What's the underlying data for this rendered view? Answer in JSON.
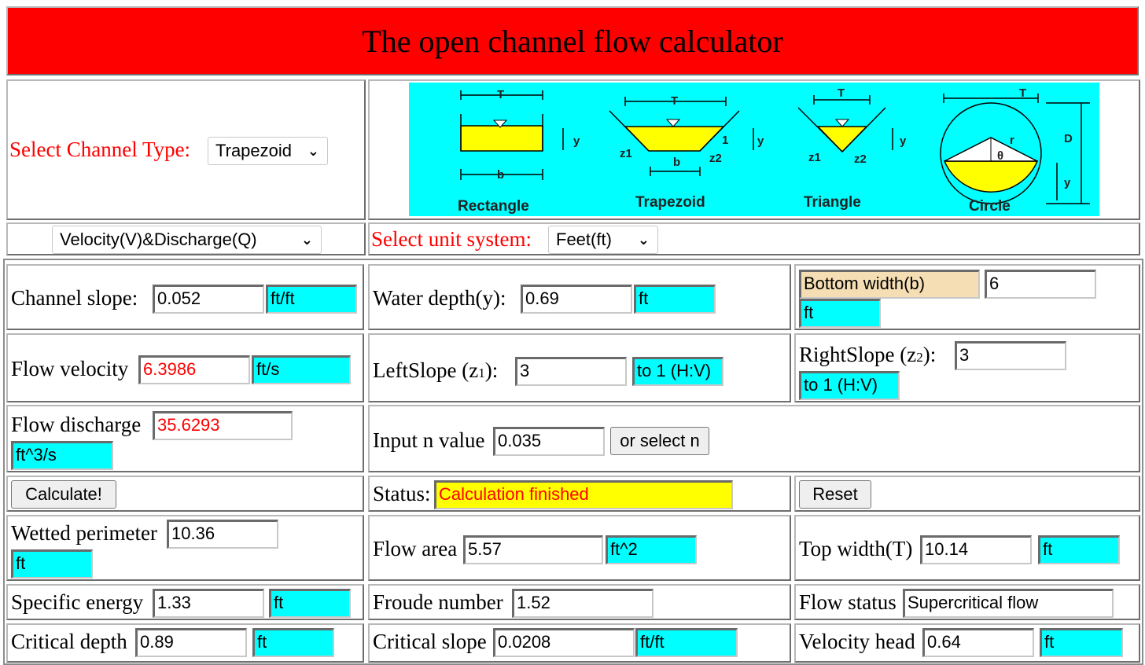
{
  "title": "The open channel flow calculator",
  "channel_type": {
    "label": "Select Channel Type:",
    "selected": "Trapezoid"
  },
  "calc_mode": {
    "selected": "Velocity(V)&Discharge(Q)"
  },
  "unit_system": {
    "label": "Select unit system:",
    "selected": "Feet(ft)"
  },
  "diagram": {
    "shapes": [
      "Rectangle",
      "Trapezoid",
      "Triangle",
      "Circle"
    ],
    "symbols": {
      "T": "T",
      "b": "b",
      "y": "y",
      "z1": "z1",
      "z2": "z2",
      "one": "1",
      "r": "r",
      "theta": "θ",
      "D": "D"
    }
  },
  "inputs": {
    "slope": {
      "label": "Channel slope:",
      "value": "0.052",
      "unit": "ft/ft"
    },
    "depth": {
      "label": "Water depth(y):",
      "value": "0.69",
      "unit": "ft"
    },
    "bottom_width": {
      "label": "Bottom width(b)",
      "value": "6",
      "unit": "ft"
    },
    "velocity": {
      "label": "Flow velocity",
      "value": "6.3986",
      "unit": "ft/s"
    },
    "left_slope": {
      "label_pre": "LeftSlope (z",
      "label_sub": "1",
      "label_post": "):",
      "value": "3",
      "unit": "to 1 (H:V)"
    },
    "right_slope": {
      "label_pre": "RightSlope (z",
      "label_sub": "2",
      "label_post": "):",
      "value": "3",
      "unit": "to 1 (H:V)"
    },
    "discharge": {
      "label": "Flow discharge",
      "value": "35.6293",
      "unit": "ft^3/s"
    },
    "n_value": {
      "label": "Input n value",
      "value": "0.035",
      "button": "or select n"
    }
  },
  "actions": {
    "calculate": "Calculate!",
    "status_label": "Status:",
    "status_value": "Calculation finished",
    "reset": "Reset"
  },
  "results": {
    "wetted_perimeter": {
      "label": "Wetted perimeter",
      "value": "10.36",
      "unit": "ft"
    },
    "flow_area": {
      "label": "Flow area",
      "value": "5.57",
      "unit": "ft^2"
    },
    "top_width": {
      "label": "Top width(T)",
      "value": "10.14",
      "unit": "ft"
    },
    "specific_energy": {
      "label": "Specific energy",
      "value": "1.33",
      "unit": "ft"
    },
    "froude": {
      "label": "Froude number",
      "value": "1.52"
    },
    "flow_status": {
      "label": "Flow status",
      "value": "Supercritical flow"
    },
    "critical_depth": {
      "label": "Critical depth",
      "value": "0.89",
      "unit": "ft"
    },
    "critical_slope": {
      "label": "Critical slope",
      "value": "0.0208",
      "unit": "ft/ft"
    },
    "velocity_head": {
      "label": "Velocity head",
      "value": "0.64",
      "unit": "ft"
    }
  },
  "colors": {
    "title_bg": "#ff0000",
    "unit_bg": "#00ffff",
    "status_bg": "#ffff00",
    "bottom_width_bg": "#f5deb3",
    "accent_text": "#ff0000"
  }
}
